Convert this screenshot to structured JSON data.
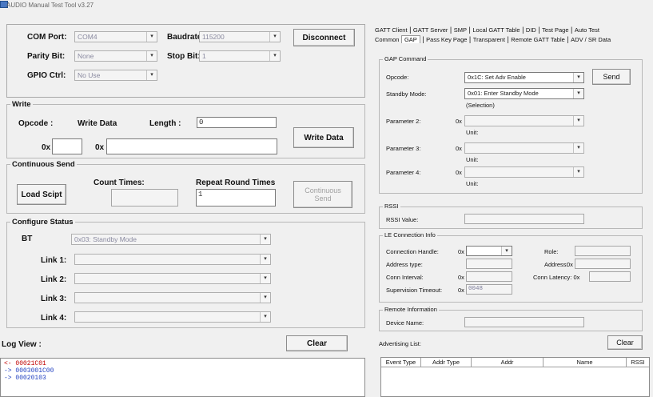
{
  "window": {
    "title": "AUDIO Manual Test Tool v3.27"
  },
  "port": {
    "com_port_label": "COM Port:",
    "com_port_value": "COM4",
    "baudrate_label": "Baudrate:",
    "baudrate_value": "115200",
    "parity_label": "Parity Bit:",
    "parity_value": "None",
    "stop_label": "Stop Bit:",
    "stop_value": "1",
    "gpio_label": "GPIO Ctrl:",
    "gpio_value": "No Use",
    "disconnect_label": "Disconnect"
  },
  "write": {
    "title": "Write",
    "opcode_label": "Opcode :",
    "write_data_label": "Write Data",
    "length_label": "Length :",
    "length_value": "0",
    "prefix1": "0x",
    "prefix2": "0x",
    "opcode_value": "",
    "data_value": "",
    "button_label": "Write Data"
  },
  "continuous": {
    "title": "Continuous Send",
    "load_label": "Load Scipt",
    "count_label": "Count Times:",
    "count_value": "",
    "repeat_label": "Repeat Round Times",
    "repeat_value": "1",
    "send_label_1": "Continuous",
    "send_label_2": "Send"
  },
  "status": {
    "title": "Configure Status",
    "bt_label": "BT",
    "bt_value": "0x03: Standby Mode",
    "links": [
      {
        "label": "Link 1:",
        "value": ""
      },
      {
        "label": "Link 2:",
        "value": ""
      },
      {
        "label": "Link 3:",
        "value": ""
      },
      {
        "label": "Link 4:",
        "value": ""
      }
    ]
  },
  "log": {
    "title": "Log View :",
    "clear_label": "Clear",
    "lines": [
      {
        "text": "<- 00021C01",
        "color": "#c00000"
      },
      {
        "text": "-> 0003001C00",
        "color": "#2040c0"
      },
      {
        "text": "-> 00020103",
        "color": "#2040c0"
      }
    ]
  },
  "tabs": {
    "row1": [
      "GATT Client",
      "GATT Server",
      "SMP",
      "Local GATT Table",
      "DID",
      "Test Page",
      "Auto Test"
    ],
    "row2": [
      "Common",
      "GAP",
      "Pass Key Page",
      "Transparent",
      "Remote GATT Table",
      "ADV / SR Data"
    ],
    "active": "GAP"
  },
  "gap": {
    "title": "GAP Command",
    "opcode_label": "Opcode:",
    "opcode_value": "0x1C: Set Adv Enable",
    "send_label": "Send",
    "standby_label": "Standby Mode:",
    "standby_value": "0x01: Enter Standby Mode",
    "standby_note": "(Selection)",
    "params": [
      {
        "label": "Parameter 2:",
        "prefix": "0x",
        "unit": "Unit:"
      },
      {
        "label": "Parameter 3:",
        "prefix": "0x",
        "unit": "Unit:"
      },
      {
        "label": "Parameter 4:",
        "prefix": "0x",
        "unit": "Unit:"
      }
    ]
  },
  "rssi": {
    "title": "RSSI",
    "label": "RSSI Value:",
    "value": ""
  },
  "le": {
    "title": "LE Connection Info",
    "handle_label": "Connection Handle:",
    "handle_prefix": "0x",
    "role_label": "Role:",
    "addr_type_label": "Address type:",
    "address_label": "Address:",
    "address_prefix": "0x",
    "interval_label": "Conn Interval:",
    "interval_prefix": "0x",
    "latency_label": "Conn Latency: 0x",
    "timeout_label": "Supervision Timeout:",
    "timeout_prefix": "0x",
    "timeout_value": "0048"
  },
  "remote": {
    "title": "Remote Information",
    "device_label": "Device Name:",
    "device_value": ""
  },
  "adv": {
    "title": "Advertising List:",
    "clear_label": "Clear",
    "columns": [
      "Event Type",
      "Addr Type",
      "Addr",
      "Name",
      "RSSI"
    ]
  }
}
